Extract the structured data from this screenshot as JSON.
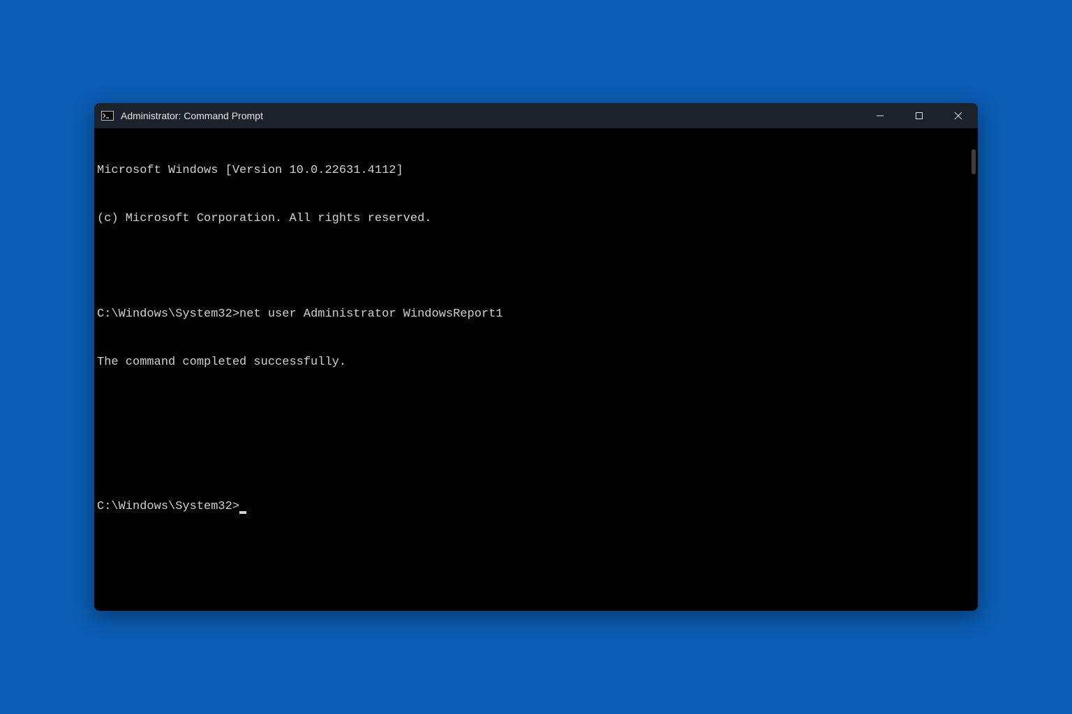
{
  "window": {
    "title": "Administrator: Command Prompt"
  },
  "terminal": {
    "line1": "Microsoft Windows [Version 10.0.22631.4112]",
    "line2": "(c) Microsoft Corporation. All rights reserved.",
    "blank1": " ",
    "prompt1_prefix": "C:\\Windows\\System32>",
    "command1": "net user Administrator WindowsReport1",
    "result1": "The command completed successfully.",
    "blank2": " ",
    "blank3": " ",
    "prompt2": "C:\\Windows\\System32>"
  }
}
